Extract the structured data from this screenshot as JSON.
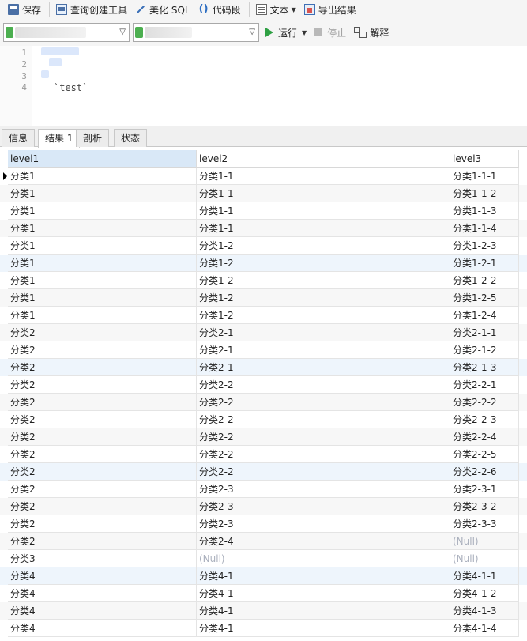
{
  "toolbar1": {
    "save": "保存",
    "query_builder": "查询创建工具",
    "beautify": "美化 SQL",
    "snippet_icon_glyph": "()",
    "snippet": "代码段",
    "text": "文本",
    "export": "导出结果"
  },
  "toolbar2": {
    "run": "运行",
    "stop": "停止",
    "explain": "解释",
    "connection_color": "#4caf50"
  },
  "editor": {
    "line_numbers": [
      "1",
      "2",
      "3",
      "4"
    ],
    "code_line4": "`test`"
  },
  "tabs": [
    "信息",
    "结果 1",
    "剖析",
    "状态"
  ],
  "grid": {
    "columns": [
      "level1",
      "level2",
      "level3"
    ],
    "null_label": "(Null)",
    "rows": [
      [
        "分类1",
        "分类1-1",
        "分类1-1-1"
      ],
      [
        "分类1",
        "分类1-1",
        "分类1-1-2"
      ],
      [
        "分类1",
        "分类1-1",
        "分类1-1-3"
      ],
      [
        "分类1",
        "分类1-1",
        "分类1-1-4"
      ],
      [
        "分类1",
        "分类1-2",
        "分类1-2-3"
      ],
      [
        "分类1",
        "分类1-2",
        "分类1-2-1"
      ],
      [
        "分类1",
        "分类1-2",
        "分类1-2-2"
      ],
      [
        "分类1",
        "分类1-2",
        "分类1-2-5"
      ],
      [
        "分类1",
        "分类1-2",
        "分类1-2-4"
      ],
      [
        "分类2",
        "分类2-1",
        "分类2-1-1"
      ],
      [
        "分类2",
        "分类2-1",
        "分类2-1-2"
      ],
      [
        "分类2",
        "分类2-1",
        "分类2-1-3"
      ],
      [
        "分类2",
        "分类2-2",
        "分类2-2-1"
      ],
      [
        "分类2",
        "分类2-2",
        "分类2-2-2"
      ],
      [
        "分类2",
        "分类2-2",
        "分类2-2-3"
      ],
      [
        "分类2",
        "分类2-2",
        "分类2-2-4"
      ],
      [
        "分类2",
        "分类2-2",
        "分类2-2-5"
      ],
      [
        "分类2",
        "分类2-2",
        "分类2-2-6"
      ],
      [
        "分类2",
        "分类2-3",
        "分类2-3-1"
      ],
      [
        "分类2",
        "分类2-3",
        "分类2-3-2"
      ],
      [
        "分类2",
        "分类2-3",
        "分类2-3-3"
      ],
      [
        "分类2",
        "分类2-4",
        null
      ],
      [
        "分类3",
        null,
        null
      ],
      [
        "分类4",
        "分类4-1",
        "分类4-1-1"
      ],
      [
        "分类4",
        "分类4-1",
        "分类4-1-2"
      ],
      [
        "分类4",
        "分类4-1",
        "分类4-1-3"
      ],
      [
        "分类4",
        "分类4-1",
        "分类4-1-4"
      ]
    ]
  }
}
